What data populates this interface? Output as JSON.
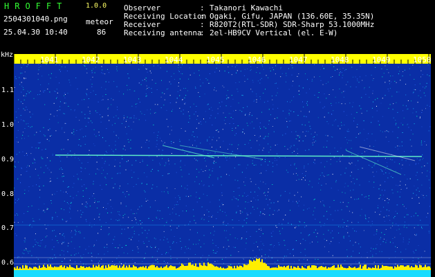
{
  "header": {
    "logo": "HROFFT",
    "version": "1.0.0",
    "filename": "2504301040.png",
    "mode": "meteor",
    "datetime": "25.04.30 10:40",
    "count": "86"
  },
  "info": [
    {
      "key": "Observer",
      "value": "Takanori Kawachi"
    },
    {
      "key": "Receiving Location",
      "value": "Ogaki, Gifu, JAPAN (136.60E, 35.35N)"
    },
    {
      "key": "Receiver",
      "value": "R820T2(RTL-SDR) SDR-Sharp 53.1000MHz"
    },
    {
      "key": "Receiving antenna",
      "value": "2el-HB9CV Vertical (el. E-W)"
    }
  ],
  "axes": {
    "x_unit": "kHz",
    "time_ticks": [
      "1041",
      "1042",
      "1043",
      "1044",
      "1045",
      "1046",
      "1047",
      "1048",
      "1049",
      "1050"
    ],
    "freq_ticks": [
      "1.1",
      "1.0",
      "0.9",
      "0.8",
      "0.7",
      "0.6"
    ]
  },
  "colors": {
    "background": "#0a2ea6",
    "noise_hi": "#19dcff",
    "echo_line": "#66ffcc",
    "spectrum_bar": "#ffee00",
    "bottom_strip": "#19dcff",
    "header_bar": "#ffff00"
  }
}
